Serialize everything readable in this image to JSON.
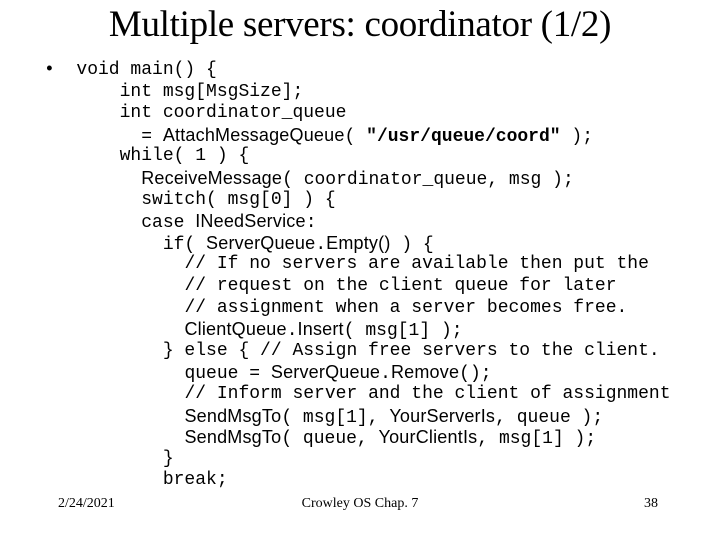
{
  "slide": {
    "title": "Multiple servers: coordinator (1/2)",
    "bullet_glyph": "•",
    "background_color": "#ffffff",
    "text_color": "#000000"
  },
  "code": {
    "lines": [
      {
        "indent": 0,
        "bullet": true,
        "segments": [
          {
            "text": "void main() {",
            "style": "plain"
          }
        ]
      },
      {
        "indent": 2,
        "bullet": false,
        "segments": [
          {
            "text": "int msg[MsgSize];",
            "style": "plain"
          }
        ]
      },
      {
        "indent": 2,
        "bullet": false,
        "segments": [
          {
            "text": "int coordinator_queue",
            "style": "plain"
          }
        ]
      },
      {
        "indent": 3,
        "bullet": false,
        "segments": [
          {
            "text": "= ",
            "style": "plain"
          },
          {
            "text": "AttachMessageQueue",
            "style": "ident"
          },
          {
            "text": "( ",
            "style": "plain"
          },
          {
            "text": "\"/usr/queue/coord\"",
            "style": "strlit"
          },
          {
            "text": " );",
            "style": "plain"
          }
        ]
      },
      {
        "indent": 2,
        "bullet": false,
        "segments": [
          {
            "text": "while( 1 ) {",
            "style": "plain"
          }
        ]
      },
      {
        "indent": 3,
        "bullet": false,
        "segments": [
          {
            "text": "Receive",
            "style": "ident"
          },
          {
            "text": "Message",
            "style": "ident"
          },
          {
            "text": "( coordinator_queue, msg );",
            "style": "plain"
          }
        ]
      },
      {
        "indent": 3,
        "bullet": false,
        "segments": [
          {
            "text": "switch( msg[0] ) {",
            "style": "plain"
          }
        ]
      },
      {
        "indent": 3,
        "bullet": false,
        "segments": [
          {
            "text": "case ",
            "style": "plain"
          },
          {
            "text": "INeedService",
            "style": "ident"
          },
          {
            "text": ":",
            "style": "plain"
          }
        ]
      },
      {
        "indent": 4,
        "bullet": false,
        "segments": [
          {
            "text": "if( ",
            "style": "plain"
          },
          {
            "text": "ServerQueue",
            "style": "ident"
          },
          {
            "text": ".",
            "style": "plain"
          },
          {
            "text": "Empty()",
            "style": "ident"
          },
          {
            "text": " ) {",
            "style": "plain"
          }
        ]
      },
      {
        "indent": 5,
        "bullet": false,
        "segments": [
          {
            "text": "// If no servers are available then put the",
            "style": "plain"
          }
        ]
      },
      {
        "indent": 5,
        "bullet": false,
        "segments": [
          {
            "text": "// request on the client queue for later",
            "style": "plain"
          }
        ]
      },
      {
        "indent": 5,
        "bullet": false,
        "segments": [
          {
            "text": "// assignment when a server becomes free.",
            "style": "plain"
          }
        ]
      },
      {
        "indent": 5,
        "bullet": false,
        "segments": [
          {
            "text": "Client",
            "style": "ident"
          },
          {
            "text": "Queue",
            "style": "ident"
          },
          {
            "text": ".",
            "style": "plain"
          },
          {
            "text": "Insert",
            "style": "ident"
          },
          {
            "text": "( msg[1] );",
            "style": "plain"
          }
        ]
      },
      {
        "indent": 4,
        "bullet": false,
        "segments": [
          {
            "text": "} else { // Assign free servers to the client.",
            "style": "plain"
          }
        ]
      },
      {
        "indent": 5,
        "bullet": false,
        "segments": [
          {
            "text": "queue = ",
            "style": "plain"
          },
          {
            "text": "ServerQueue",
            "style": "ident"
          },
          {
            "text": ".",
            "style": "plain"
          },
          {
            "text": "Remove",
            "style": "ident"
          },
          {
            "text": "();",
            "style": "plain"
          }
        ]
      },
      {
        "indent": 5,
        "bullet": false,
        "segments": [
          {
            "text": "// Inform server and the client of assignment",
            "style": "plain"
          }
        ]
      },
      {
        "indent": 5,
        "bullet": false,
        "segments": [
          {
            "text": "Send",
            "style": "ident"
          },
          {
            "text": "Msg",
            "style": "ident"
          },
          {
            "text": "To",
            "style": "ident"
          },
          {
            "text": "( msg[1], ",
            "style": "plain"
          },
          {
            "text": "Your",
            "style": "ident"
          },
          {
            "text": "Server",
            "style": "ident"
          },
          {
            "text": "Is",
            "style": "ident"
          },
          {
            "text": ", queue );",
            "style": "plain"
          }
        ]
      },
      {
        "indent": 5,
        "bullet": false,
        "segments": [
          {
            "text": "Send",
            "style": "ident"
          },
          {
            "text": "Msg",
            "style": "ident"
          },
          {
            "text": "To",
            "style": "ident"
          },
          {
            "text": "( queue, ",
            "style": "plain"
          },
          {
            "text": "Your",
            "style": "ident"
          },
          {
            "text": "Client",
            "style": "ident"
          },
          {
            "text": "Is",
            "style": "ident"
          },
          {
            "text": ", msg[1] );",
            "style": "plain"
          }
        ]
      },
      {
        "indent": 4,
        "bullet": false,
        "segments": [
          {
            "text": "}",
            "style": "plain"
          }
        ]
      },
      {
        "indent": 4,
        "bullet": false,
        "segments": [
          {
            "text": "break;",
            "style": "plain"
          }
        ]
      }
    ]
  },
  "footer": {
    "date": "2/24/2021",
    "center": "Crowley  OS  Chap. 7",
    "page": "38"
  }
}
